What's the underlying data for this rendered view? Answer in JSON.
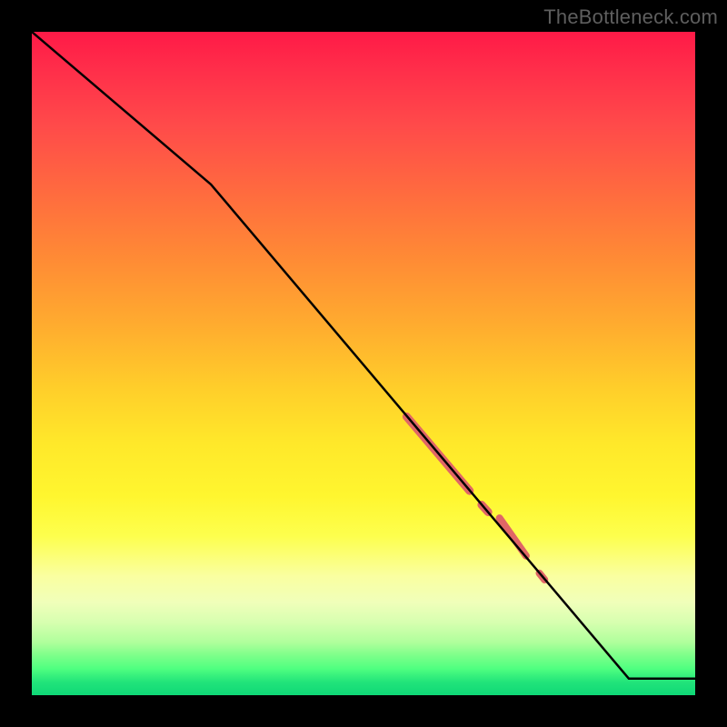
{
  "watermark": "TheBottleneck.com",
  "chart_data": {
    "type": "line",
    "title": "",
    "xlabel": "",
    "ylabel": "",
    "xlim": [
      0,
      100
    ],
    "ylim": [
      0,
      100
    ],
    "grid": false,
    "series": [
      {
        "name": "curve",
        "color": "#000000",
        "width": 2.5,
        "x": [
          0,
          27,
          90,
          100
        ],
        "y": [
          100,
          77,
          2.5,
          2.5
        ]
      }
    ],
    "highlights": [
      {
        "x0": 56.5,
        "y0": 42.0,
        "x1": 66.0,
        "y1": 30.8,
        "w": 9,
        "kind": "thick"
      },
      {
        "x0": 67.8,
        "y0": 28.7,
        "x1": 68.8,
        "y1": 27.6,
        "w": 9,
        "kind": "dot"
      },
      {
        "x0": 70.5,
        "y0": 26.7,
        "x1": 74.5,
        "y1": 21.0,
        "w": 8,
        "kind": "thick"
      },
      {
        "x0": 76.5,
        "y0": 18.4,
        "x1": 77.3,
        "y1": 17.4,
        "w": 8,
        "kind": "dot"
      }
    ],
    "highlight_color": "#e06666"
  }
}
